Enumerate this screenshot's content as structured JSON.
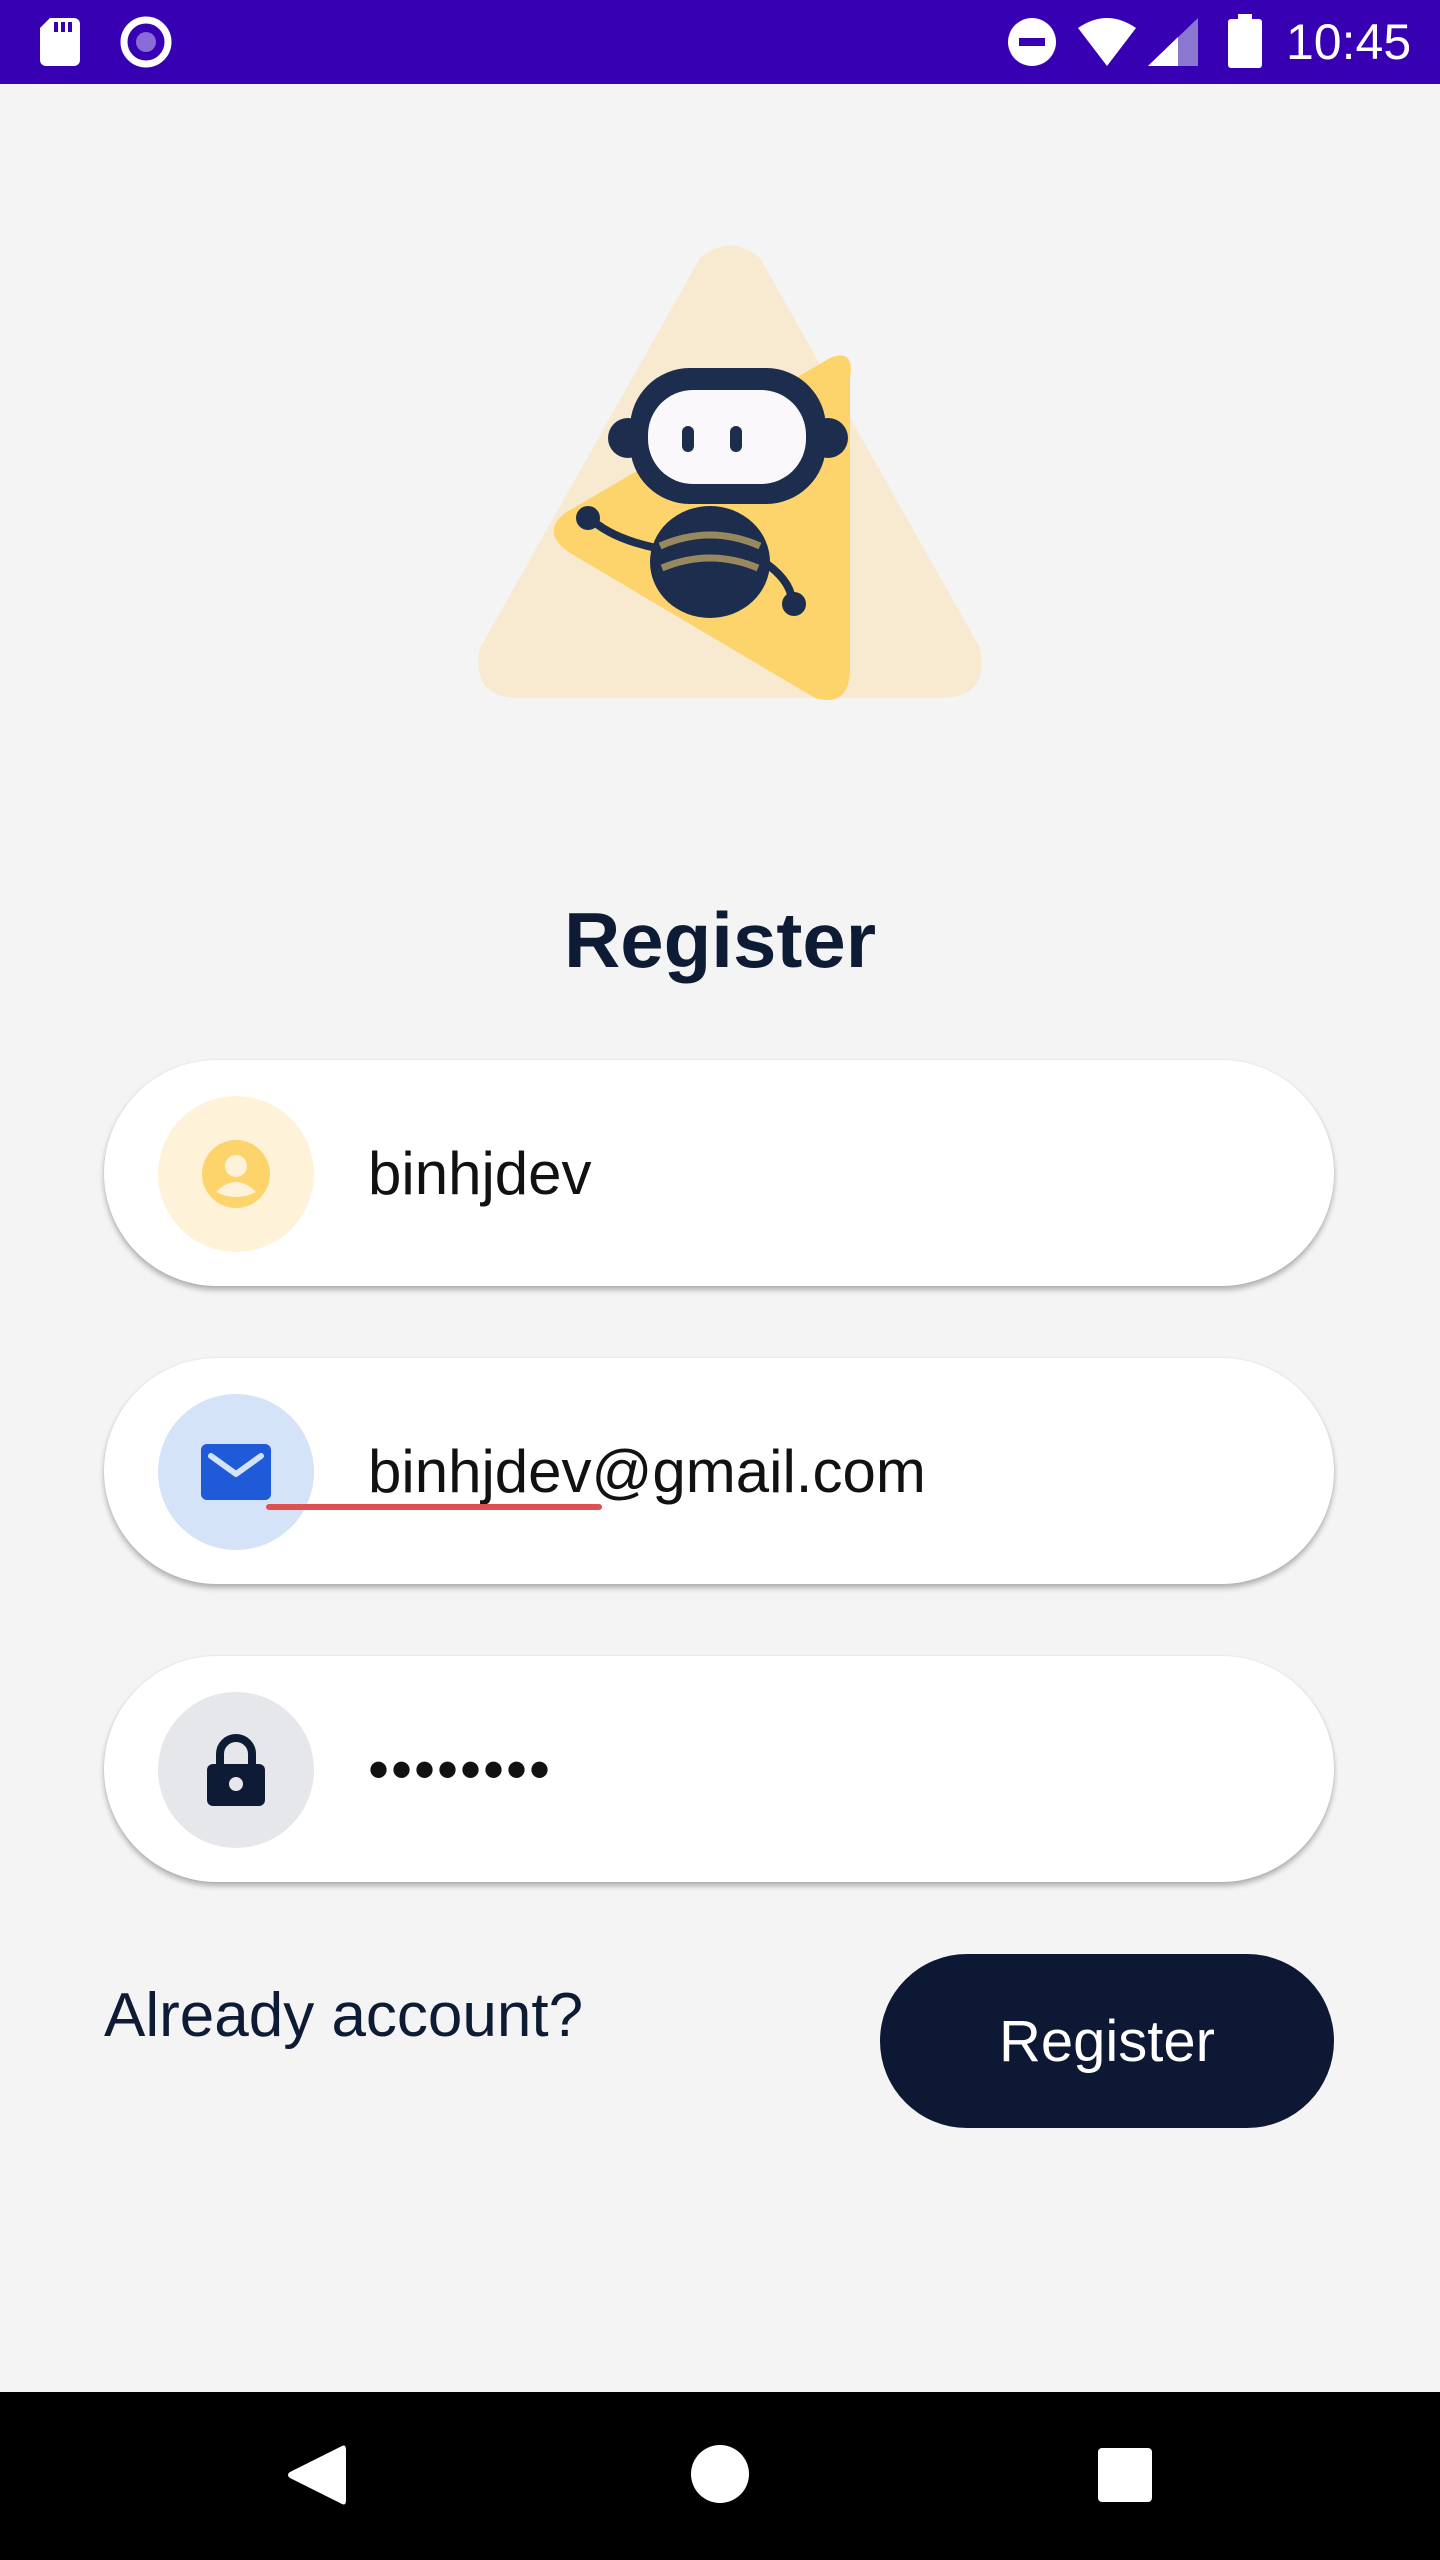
{
  "status_bar": {
    "time": "10:45",
    "icons": [
      "sd-card-icon",
      "radio-button-icon",
      "do-not-disturb-icon",
      "wifi-icon",
      "signal-icon",
      "battery-icon"
    ],
    "background": "#3700b3"
  },
  "illustration": {
    "name": "robot-mascot",
    "colors": {
      "triangle_back": "#f7ead0",
      "triangle_front": "#fdd36b",
      "robot_dark": "#1c2d4e",
      "face": "#fbf8fb"
    }
  },
  "form": {
    "title": "Register",
    "username": {
      "value": "binhjdev",
      "icon": "user-icon"
    },
    "email": {
      "value": "binhjdev@gmail.com",
      "icon": "mail-icon"
    },
    "password": {
      "value": "••••••••",
      "icon": "lock-icon"
    }
  },
  "actions": {
    "already_account": "Already account?",
    "register_label": "Register",
    "button_color": "#0d1834"
  },
  "nav_bar": {
    "buttons": [
      "back-icon",
      "home-icon",
      "recents-icon"
    ]
  }
}
